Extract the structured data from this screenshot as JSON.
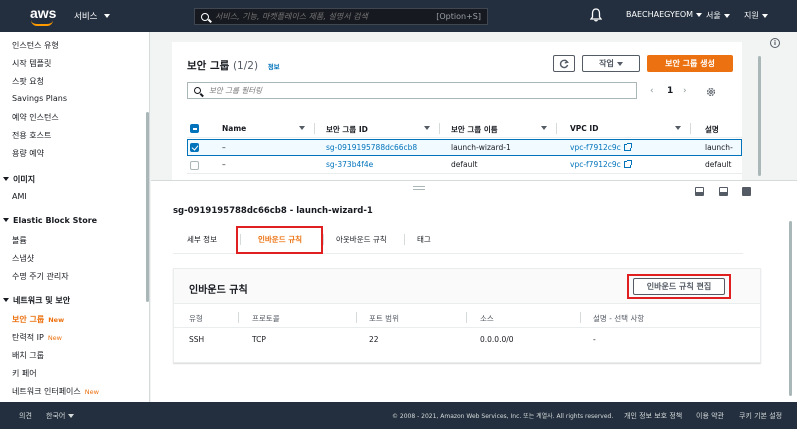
{
  "topnav": {
    "logo": "aws",
    "services_label": "서비스",
    "search_placeholder": "서비스, 기능, 마켓플레이스 제품, 설명서 검색",
    "search_shortcut": "[Option+S]",
    "account": "BAECHAEGYEOM",
    "region": "서울",
    "support": "지원"
  },
  "sidebar": {
    "items": [
      {
        "label": "인스턴스 유형"
      },
      {
        "label": "시작 템플릿"
      },
      {
        "label": "스팟 요청"
      },
      {
        "label": "Savings Plans"
      },
      {
        "label": "예약 인스턴스"
      },
      {
        "label": "전용 호스트"
      },
      {
        "label": "용량 예약"
      }
    ],
    "images_head": "이미지",
    "images_items": [
      {
        "label": "AMI"
      }
    ],
    "ebs_head": "Elastic Block Store",
    "ebs_items": [
      {
        "label": "볼륨"
      },
      {
        "label": "스냅샷"
      },
      {
        "label": "수명 주기 관리자"
      }
    ],
    "network_head": "네트워크 및 보안",
    "network_items": [
      {
        "label": "보안 그룹",
        "badge": "New"
      },
      {
        "label": "탄력적 IP",
        "badge": "New"
      },
      {
        "label": "배치 그룹"
      },
      {
        "label": "키 페어"
      },
      {
        "label": "네트워크 인터페이스",
        "badge": "New"
      }
    ]
  },
  "sg_list": {
    "title": "보안 그룹",
    "count": "(1/2)",
    "info": "정보",
    "actions_label": "작업",
    "create_label": "보안 그룹 생성",
    "filter_placeholder": "보안 그룹 필터링",
    "page": "1",
    "columns": [
      "Name",
      "보안 그룹 ID",
      "보안 그룹 이름",
      "VPC ID",
      "설명"
    ],
    "rows": [
      {
        "name": "–",
        "id": "sg-0919195788dc66cb8",
        "group_name": "launch-wizard-1",
        "vpc": "vpc-f7912c9c",
        "desc": "launch-"
      },
      {
        "name": "–",
        "id": "sg-373b4f4e",
        "group_name": "default",
        "vpc": "vpc-f7912c9c",
        "desc": "default"
      }
    ]
  },
  "detail": {
    "title": "sg-0919195788dc66cb8 - launch-wizard-1",
    "tabs": [
      "세부 정보",
      "인바운드 규칙",
      "아웃바운드 규칙",
      "태그"
    ],
    "inbound": {
      "title": "인바운드 규칙",
      "edit_label": "인바운드 규칙 편집",
      "columns": [
        "유형",
        "프로토콜",
        "포트 범위",
        "소스",
        "설명 - 선택 사항"
      ],
      "row": [
        "SSH",
        "TCP",
        "22",
        "0.0.0.0/0",
        "-"
      ]
    }
  },
  "footer": {
    "feedback": "의견",
    "language": "한국어",
    "copyright": "© 2008 - 2021, Amazon Web Services, Inc. 또는 계열사. All rights reserved.",
    "privacy": "개인 정보 보호 정책",
    "terms": "이용 약관",
    "cookies": "쿠키 기본 설정"
  },
  "colors": {
    "accent": "#ec7211",
    "nav_bg": "#232f3e",
    "link": "#0073bb",
    "highlight": "#e02020"
  }
}
